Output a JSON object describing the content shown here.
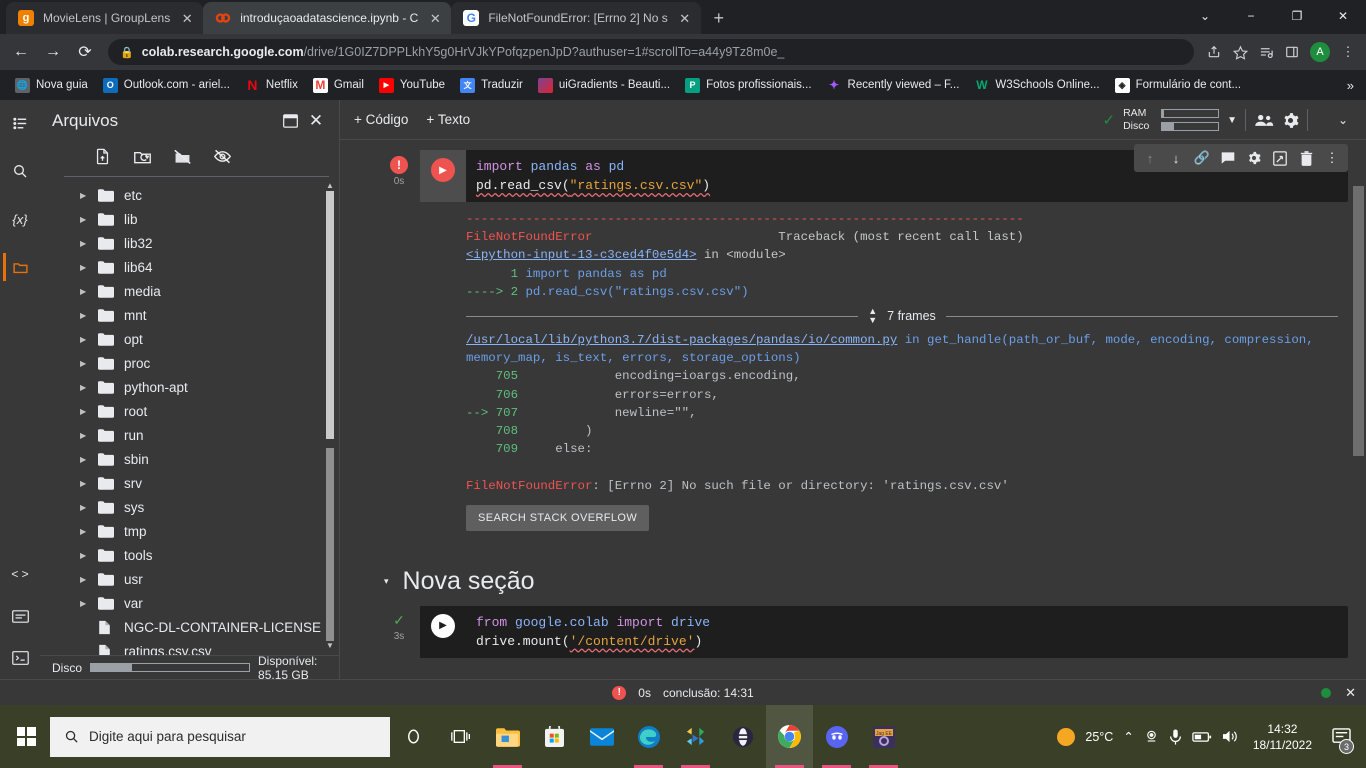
{
  "browser": {
    "tabs": [
      {
        "title": "MovieLens | GroupLens",
        "favicon": "grouplens-icon",
        "favicon_color": "#f08000",
        "favicon_letter": "g",
        "active": false
      },
      {
        "title": "introduçaoadatascience.ipynb - C",
        "favicon": "colab-icon",
        "favicon_color": "#e8710a",
        "favicon_letter": "",
        "active": true
      },
      {
        "title": "FileNotFoundError: [Errno 2] No s",
        "favicon": "google-icon",
        "favicon_color": "#ffffff",
        "favicon_letter": "G",
        "active": false
      }
    ],
    "new_tab_label": "+",
    "window_controls": {
      "minimize_all": "⌄",
      "minimize": "−",
      "maximize": "❐",
      "close": "✕"
    },
    "nav": {
      "back": "←",
      "forward": "→",
      "reload": "⟳"
    },
    "address": {
      "lock_icon": "lock-icon",
      "domain": "colab.research.google.com",
      "path": "/drive/1G0IZ7DPPLkhY5g0HrVJkYPofqzpenJpD?authuser=1#scrollTo=a44y9Tz8m0e_"
    },
    "toolbar_icons": [
      "share-icon",
      "bookmark-star-icon",
      "reading-list-icon",
      "side-panel-icon"
    ],
    "profile_initial": "A",
    "menu_icon": "three-dot-menu-icon",
    "bookmarks": [
      {
        "label": "Nova guia",
        "icon": "globe-icon",
        "color": "#5f6368",
        "letter": ""
      },
      {
        "label": "Outlook.com - ariel...",
        "icon": "outlook-icon",
        "color": "#0f6cbd",
        "letter": "O"
      },
      {
        "label": "Netflix",
        "icon": "netflix-icon",
        "color": "#e50914",
        "letter": "N"
      },
      {
        "label": "Gmail",
        "icon": "gmail-icon",
        "color": "#ffffff",
        "letter": "M"
      },
      {
        "label": "YouTube",
        "icon": "youtube-icon",
        "color": "#ff0000",
        "letter": "▶"
      },
      {
        "label": "Traduzir",
        "icon": "google-translate-icon",
        "color": "#4285f4",
        "letter": "文"
      },
      {
        "label": "uiGradients - Beauti...",
        "icon": "uigradients-icon",
        "color": "#b6356c",
        "letter": ""
      },
      {
        "label": "Fotos profissionais...",
        "icon": "pexels-icon",
        "color": "#05a081",
        "letter": "P"
      },
      {
        "label": "Recently viewed – F...",
        "icon": "figma-icon",
        "color": "#a259ff",
        "letter": "F"
      },
      {
        "label": "W3Schools Online...",
        "icon": "w3schools-icon",
        "color": "#04aa6d",
        "letter": "W"
      },
      {
        "label": "Formulário de cont...",
        "icon": "form-icon",
        "color": "#ffffff",
        "letter": "◈"
      }
    ],
    "bookmarks_overflow": "»"
  },
  "colab": {
    "rail": [
      {
        "name": "table-of-contents-icon",
        "glyph": "☰",
        "active": false
      },
      {
        "name": "search-icon",
        "glyph": "🔍",
        "active": false
      },
      {
        "name": "variables-icon",
        "glyph": "{x}",
        "active": false
      },
      {
        "name": "files-icon",
        "glyph": "▭",
        "active": true
      }
    ],
    "rail_bottom": [
      {
        "name": "code-snippets-icon",
        "glyph": "< >"
      },
      {
        "name": "command-palette-icon",
        "glyph": "▤"
      },
      {
        "name": "terminal-icon",
        "glyph": ">_"
      }
    ],
    "files_panel": {
      "title": "Arquivos",
      "header_buttons": [
        "open-in-new-window-icon",
        "close-panel-icon"
      ],
      "toolbar": [
        "upload-file-icon",
        "refresh-folder-icon",
        "mount-drive-icon",
        "toggle-hidden-icon"
      ],
      "tree": [
        {
          "label": "etc",
          "type": "folder"
        },
        {
          "label": "lib",
          "type": "folder"
        },
        {
          "label": "lib32",
          "type": "folder"
        },
        {
          "label": "lib64",
          "type": "folder"
        },
        {
          "label": "media",
          "type": "folder"
        },
        {
          "label": "mnt",
          "type": "folder"
        },
        {
          "label": "opt",
          "type": "folder"
        },
        {
          "label": "proc",
          "type": "folder"
        },
        {
          "label": "python-apt",
          "type": "folder"
        },
        {
          "label": "root",
          "type": "folder"
        },
        {
          "label": "run",
          "type": "folder"
        },
        {
          "label": "sbin",
          "type": "folder"
        },
        {
          "label": "srv",
          "type": "folder"
        },
        {
          "label": "sys",
          "type": "folder"
        },
        {
          "label": "tmp",
          "type": "folder"
        },
        {
          "label": "tools",
          "type": "folder"
        },
        {
          "label": "usr",
          "type": "folder"
        },
        {
          "label": "var",
          "type": "folder"
        },
        {
          "label": "NGC-DL-CONTAINER-LICENSE",
          "type": "file"
        },
        {
          "label": "ratings.csv.csv",
          "type": "file"
        }
      ],
      "disk_label": "Disco",
      "disk_available": "Disponível: 85.15 GB",
      "disk_used_percent": 26
    },
    "toolbar": {
      "add_code": "+ Código",
      "add_text": "+ Texto",
      "connected_check": "✓",
      "ram_label": "RAM",
      "disk_label": "Disco",
      "ram_percent": 4,
      "disk_percent": 22,
      "dropdown_icon": "chevron-down-icon",
      "share_icon": "people-icon",
      "settings_icon": "gear-icon",
      "collapse_icon": "chevron-down-icon"
    },
    "cell_toolbar": [
      "move-cell-up-icon",
      "move-cell-down-icon",
      "link-to-cell-icon",
      "add-comment-icon",
      "cell-settings-icon",
      "mirror-cell-icon",
      "delete-cell-icon",
      "more-options-icon"
    ],
    "cells": [
      {
        "exec_state": "error",
        "exec_time": "0s",
        "code_lines": [
          {
            "parts": [
              {
                "t": "import ",
                "c": "k-kw"
              },
              {
                "t": "pandas ",
                "c": "k-mod"
              },
              {
                "t": "as ",
                "c": "k-kw"
              },
              {
                "t": "pd",
                "c": "k-mod"
              }
            ]
          },
          {
            "parts": [
              {
                "t": "pd.read_csv(",
                "c": "k-fn"
              },
              {
                "t": "\"ratings.csv.csv\"",
                "c": "k-str"
              },
              {
                "t": ")",
                "c": "k-fn"
              }
            ],
            "squiggle": true
          }
        ]
      },
      {
        "exec_state": "ok",
        "exec_time": "3s",
        "code_lines": [
          {
            "parts": [
              {
                "t": "from ",
                "c": "k-kw"
              },
              {
                "t": "google.colab ",
                "c": "k-mod"
              },
              {
                "t": "import ",
                "c": "k-kw"
              },
              {
                "t": "drive",
                "c": "k-mod"
              }
            ]
          },
          {
            "parts": [
              {
                "t": "drive.mount(",
                "c": "k-fn"
              },
              {
                "t": "'/content/drive'",
                "c": "k-str"
              },
              {
                "t": ")",
                "c": "k-fn"
              }
            ]
          }
        ]
      }
    ],
    "output": {
      "separator": "---------------------------------------------------------------------------",
      "error_name": "FileNotFoundError",
      "traceback_label": "Traceback (most recent call last)",
      "input_ref": "<ipython-input-13-c3ced4f0e5d4>",
      "input_ref_suffix": " in <module>",
      "src_line_1_no": "      1 ",
      "src_line_1": "import pandas as pd",
      "src_line_2_marker": "----> 2 ",
      "src_line_2": "pd.read_csv(\"ratings.csv.csv\")",
      "frames_count": "7 frames",
      "frame_path": "/usr/local/lib/python3.7/dist-packages/pandas/io/common.py",
      "frame_func_head": " in get_handle(path_or_buf, mode, encoding, compression,",
      "frame_func_tail": "memory_map, is_text, errors, storage_options)",
      "code_rows": [
        {
          "marker": "    ",
          "lineno": "705",
          "code": "            encoding=ioargs.encoding,"
        },
        {
          "marker": "    ",
          "lineno": "706",
          "code": "            errors=errors,"
        },
        {
          "marker": "--> ",
          "lineno": "707",
          "code": "            newline=\"\","
        },
        {
          "marker": "    ",
          "lineno": "708",
          "code": "        )"
        },
        {
          "marker": "    ",
          "lineno": "709",
          "code": "    else:"
        }
      ],
      "final_error_name": "FileNotFoundError",
      "final_error_msg": ": [Errno 2] No such file or directory: 'ratings.csv.csv'",
      "search_button": "SEARCH STACK OVERFLOW"
    },
    "section": {
      "title": "Nova seção",
      "caret": "▾"
    },
    "statusbar": {
      "error_glyph": "!",
      "duration": "0s",
      "completion": "conclusão: 14:31"
    }
  },
  "taskbar": {
    "search_placeholder": "Digite aqui para pesquisar",
    "search_icon": "search-icon",
    "start_icon": "windows-start-icon",
    "apps": [
      {
        "name": "cortana-icon",
        "running": false
      },
      {
        "name": "task-view-icon",
        "running": false
      },
      {
        "name": "file-explorer-icon",
        "running": true
      },
      {
        "name": "microsoft-store-icon",
        "running": false
      },
      {
        "name": "mail-icon",
        "running": false
      },
      {
        "name": "microsoft-edge-icon",
        "running": true
      },
      {
        "name": "vscode-icon",
        "running": false
      },
      {
        "name": "opera-gx-icon",
        "running": false
      },
      {
        "name": "google-chrome-icon",
        "running": true,
        "focused": true
      },
      {
        "name": "discord-icon",
        "running": true
      },
      {
        "name": "jagex-ide-icon",
        "running": true
      }
    ],
    "weather": {
      "icon": "sun-icon",
      "temperature": "25°C"
    },
    "tray": [
      "show-hidden-icons-chevron",
      "webcam-icon",
      "microphone-icon",
      "battery-icon",
      "volume-icon"
    ],
    "clock": {
      "time": "14:32",
      "date": "18/11/2022"
    },
    "notifications": {
      "icon": "action-center-icon",
      "count": "3"
    }
  }
}
